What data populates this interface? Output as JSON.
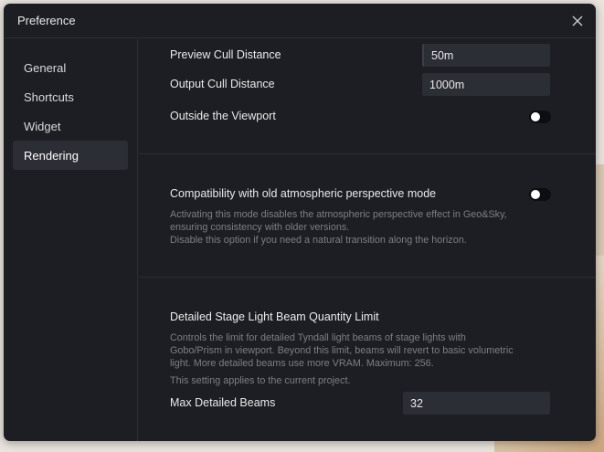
{
  "window": {
    "title": "Preference"
  },
  "sidebar": {
    "items": [
      {
        "label": "General",
        "active": false
      },
      {
        "label": "Shortcuts",
        "active": false
      },
      {
        "label": "Widget",
        "active": false
      },
      {
        "label": "Rendering",
        "active": true
      }
    ]
  },
  "rendering": {
    "preview_cull_distance": {
      "label": "Preview Cull Distance",
      "value": "50m"
    },
    "output_cull_distance": {
      "label": "Output Cull Distance",
      "value": "1000m"
    },
    "outside_viewport": {
      "label": "Outside the Viewport",
      "enabled": false
    },
    "compat_atmospheric": {
      "label": "Compatibility with old atmospheric perspective mode",
      "enabled": false,
      "desc_line1": "Activating this mode disables the atmospheric perspective effect in Geo&Sky,",
      "desc_line2": "ensuring consistency with older versions.",
      "desc_line3": "Disable this option if you need a natural transition along the horizon."
    },
    "beam_limit": {
      "title": "Detailed Stage Light Beam Quantity Limit",
      "desc_line1": "Controls the limit for detailed Tyndall light beams of stage lights with",
      "desc_line2": "Gobo/Prism in viewport. Beyond this limit, beams will revert to basic volumetric",
      "desc_line3": "light. More detailed beams use more VRAM. Maximum: 256.",
      "desc_line4": "This setting applies to the current project.",
      "max_label": "Max Detailed Beams",
      "max_value": "32"
    }
  },
  "colors": {
    "dialog_bg": "#1c1e23",
    "field_bg": "#2c2e35",
    "active_nav": "#2b2e35",
    "muted_text": "#7c7f86"
  },
  "icons": {
    "close": "close-icon"
  }
}
